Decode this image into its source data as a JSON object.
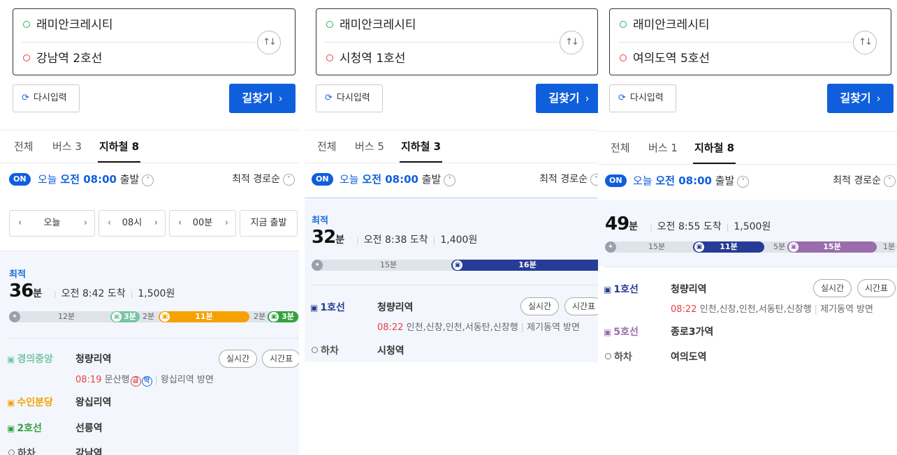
{
  "common": {
    "origin": "래미안크레시티",
    "swap_icon": "swap-arrows-icon",
    "reset_label": "다시입력",
    "search_label": "길찾기",
    "tab_all": "전체",
    "on_label": "ON",
    "today": "오늘",
    "depart_time": "오전 08:00",
    "depart_word": "출발",
    "sort_label": "최적 경로순",
    "best_label": "최적",
    "min_unit": "분",
    "realtime_label": "실시간",
    "timetable_label": "시간표",
    "alight_label": "하차",
    "colors": {
      "accent": "#0f5fdc",
      "gyeongui": "#77c4a3",
      "suinbundang": "#f5a200",
      "line2": "#33a23d",
      "line1": "#263c96",
      "line5": "#996cac"
    }
  },
  "panel1": {
    "destination": "강남역 2호선",
    "tab_bus": "버스 3",
    "tab_subway": "지하철 8",
    "time_picker": {
      "day": "오늘",
      "hour": "08시",
      "minute": "00분",
      "now": "지금 출발"
    },
    "total_minutes": "36",
    "arrival": "오전 8:42 도착",
    "fare": "1,500원",
    "bar": {
      "walk1": "12분",
      "seg1": "3분",
      "gap1": "2분",
      "seg2": "11분",
      "gap2": "2분",
      "seg3": "3분"
    },
    "legs": [
      {
        "line": "경의중앙",
        "station": "청량리역",
        "time": "08:19",
        "dest": "문산행",
        "badge1": "급",
        "badge2": "막",
        "direction": "왕십리역 방면"
      },
      {
        "line": "수인분당",
        "station": "왕십리역"
      },
      {
        "line": "2호선",
        "station": "선릉역"
      }
    ],
    "alight_station": "강남역"
  },
  "panel2": {
    "destination": "시청역 1호선",
    "tab_bus": "버스 5",
    "tab_subway": "지하철 3",
    "total_minutes": "32",
    "arrival": "오전 8:38 도착",
    "fare": "1,400원",
    "bar": {
      "walk1": "15분",
      "seg1": "16분"
    },
    "legs": [
      {
        "line": "1호선",
        "station": "청량리역",
        "time": "08:22",
        "dest": "인천,신창,인천,서동탄,신창행",
        "direction": "제기동역 방면"
      }
    ],
    "alight_station": "시청역"
  },
  "panel3": {
    "destination": "여의도역 5호선",
    "tab_bus": "버스 1",
    "tab_subway": "지하철 8",
    "total_minutes": "49",
    "arrival": "오전 8:55 도착",
    "fare": "1,500원",
    "bar": {
      "walk1": "15분",
      "seg1": "11분",
      "gap1": "5분",
      "seg2": "15분",
      "walk2": "1분"
    },
    "legs": [
      {
        "line": "1호선",
        "station": "청량리역",
        "time": "08:22",
        "dest": "인천,신창,인천,서동탄,신창행",
        "direction": "제기동역 방면"
      },
      {
        "line": "5호선",
        "station": "종로3가역"
      }
    ],
    "alight_station": "여의도역"
  }
}
